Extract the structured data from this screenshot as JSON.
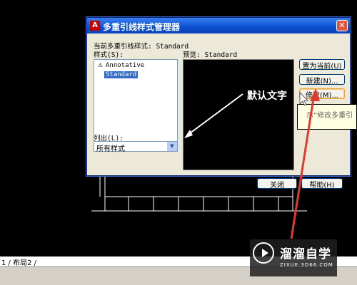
{
  "dialog": {
    "title": "多重引线样式管理器",
    "current_style_label": "当前多重引线样式: Standard",
    "styles_label": "样式(S):",
    "preview_label": "预览: Standard",
    "styles": [
      {
        "name": "Annotative",
        "selected": false,
        "annotative": true
      },
      {
        "name": "Standard",
        "selected": true,
        "annotative": false
      }
    ],
    "list_label": "列出(L):",
    "list_filter": "所有样式",
    "buttons": {
      "set_current": "置为当前(U)",
      "new": "新建(N)...",
      "modify": "修改(M)...",
      "close": "关闭",
      "help": "帮助(H)"
    }
  },
  "tooltip": {
    "text": "示“修改多重引"
  },
  "annotation": {
    "callout": "默认文字"
  },
  "layout_tabs": "1 / 布局2 /",
  "watermark": {
    "title": "溜溜自学",
    "url": "ZIXUE.3D66.COM"
  },
  "colors": {
    "titlebar": "#0a4fd0",
    "selection": "#316ac5",
    "arrow": "#e03a2e"
  }
}
